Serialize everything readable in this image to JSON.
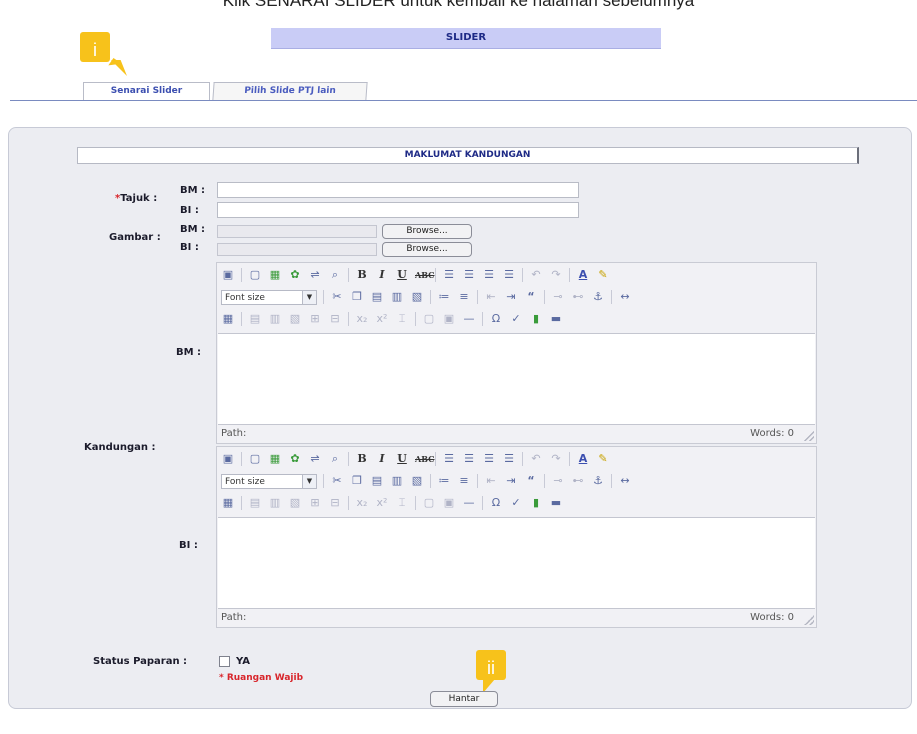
{
  "caption": "Klik SENARAI SLIDER untuk kembali ke halaman sebelumnya",
  "header": {
    "title": "SLIDER"
  },
  "callouts": {
    "first": "i",
    "second": "ii"
  },
  "tabs": [
    {
      "label": "Senarai Slider",
      "active": true
    },
    {
      "label": "Pilih Slide PTJ lain",
      "active": false
    }
  ],
  "section": {
    "title": "MAKLUMAT KANDUNGAN"
  },
  "form": {
    "tajuk": {
      "label": "Tajuk :",
      "required_mark": "*",
      "bm_label": "BM :",
      "bi_label": "BI :",
      "bm_value": "",
      "bi_value": ""
    },
    "gambar": {
      "label": "Gambar :",
      "bm_label": "BM :",
      "bi_label": "BI :",
      "browse_label": "Browse..."
    },
    "kandungan": {
      "label": "Kandungan :",
      "bm_label": "BM :",
      "bi_label": "BI :"
    },
    "status": {
      "label": "Status Paparan :",
      "checkbox_label": "YA",
      "checked": false
    },
    "required_note": "* Ruangan Wajib",
    "submit_label": "Hantar"
  },
  "editor": {
    "font_size_placeholder": "Font size",
    "path_label": "Path:",
    "words_label": "Words: 0"
  },
  "icons": [
    "image-icon",
    "new-document-icon",
    "insert-image-icon",
    "insert-flash-icon",
    "insert-link-icon",
    "search-replace-icon",
    "bold-icon",
    "italic-icon",
    "underline-icon",
    "strikethrough-icon",
    "align-left-icon",
    "align-center-icon",
    "align-right-icon",
    "align-justify-icon",
    "undo-icon",
    "redo-icon",
    "font-color-icon",
    "highlight-icon",
    "cut-icon",
    "copy-icon",
    "paste-icon",
    "paste-text-icon",
    "paste-word-icon",
    "bullet-list-icon",
    "numbered-list-icon",
    "outdent-icon",
    "indent-icon",
    "blockquote-icon",
    "unlink-icon",
    "anchor-icon",
    "insert-table-icon",
    "horizontal-rule-icon",
    "special-char-icon",
    "spellcheck-icon",
    "media-icon",
    "checkbox-icon"
  ],
  "colors": {
    "accent": "#4a5cbf",
    "header_bg": "#c9ccf6",
    "required": "#d8252b",
    "callout": "#f7c21b"
  }
}
